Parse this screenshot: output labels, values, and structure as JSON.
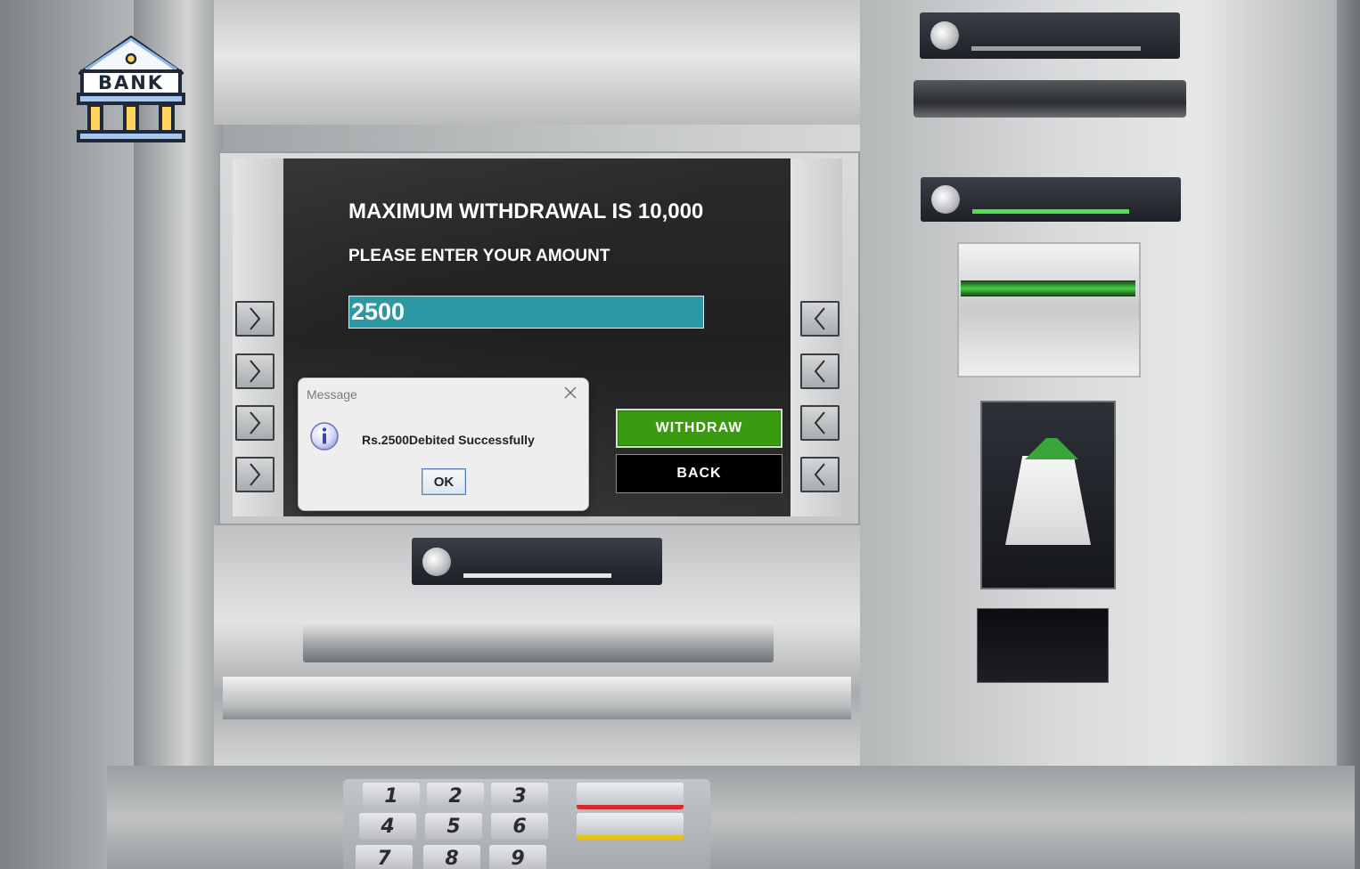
{
  "logo": {
    "text": "BANK",
    "icon": "bank-building-icon"
  },
  "screen": {
    "heading_max": "MAXIMUM WITHDRAWAL IS 10,000",
    "heading_prompt": "PLEASE ENTER YOUR AMOUNT",
    "amount_value": "2500",
    "withdraw_label": "WITHDRAW",
    "back_label": "BACK"
  },
  "dialog": {
    "title": "Message",
    "message": "Rs.2500Debited Successfully",
    "ok_label": "OK",
    "icon": "info-icon",
    "close_icon": "close-icon"
  },
  "keypad": {
    "keys": [
      "1",
      "2",
      "3",
      "4",
      "5",
      "6",
      "7",
      "8",
      "9"
    ]
  },
  "colors": {
    "withdraw": "#3a9a10",
    "back": "#000000",
    "amount_field": "#2b98a3",
    "screen": "#262626"
  }
}
